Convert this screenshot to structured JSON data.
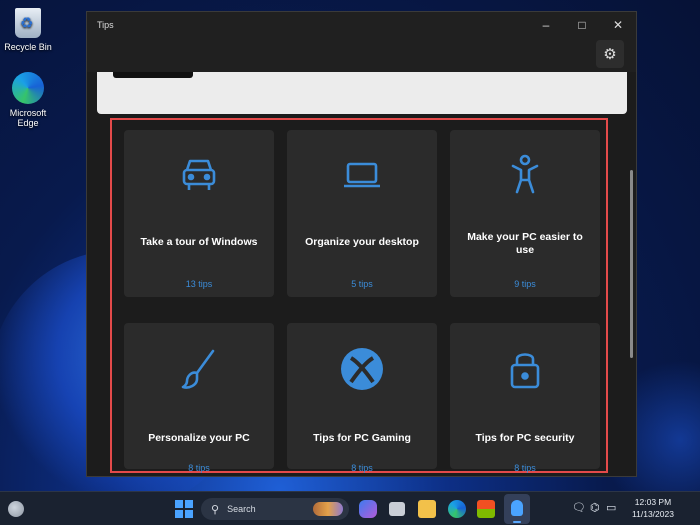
{
  "desktop": {
    "icons": [
      {
        "label": "Recycle Bin",
        "icon": "recycle-bin-icon"
      },
      {
        "label": "Microsoft Edge",
        "icon": "edge-icon"
      }
    ]
  },
  "window": {
    "title": "Tips",
    "controls": {
      "minimize": "–",
      "maximize": "□",
      "close": "✕"
    },
    "settings_icon": "gear-icon",
    "cards": [
      {
        "title": "Take a tour of Windows",
        "count": "13 tips",
        "icon": "car-icon"
      },
      {
        "title": "Organize your desktop",
        "count": "5 tips",
        "icon": "laptop-icon"
      },
      {
        "title": "Make your PC easier to use",
        "count": "9 tips",
        "icon": "accessibility-icon"
      },
      {
        "title": "Personalize your PC",
        "count": "8 tips",
        "icon": "paintbrush-icon"
      },
      {
        "title": "Tips for PC Gaming",
        "count": "8 tips",
        "icon": "xbox-icon"
      },
      {
        "title": "Tips for PC security",
        "count": "8 tips",
        "icon": "lock-icon"
      }
    ],
    "accent_color": "#3b8cd9",
    "highlight_color": "#e34a4a"
  },
  "taskbar": {
    "search_placeholder": "Search",
    "clock_time": "12:03 PM",
    "clock_date": "11/13/2023"
  }
}
